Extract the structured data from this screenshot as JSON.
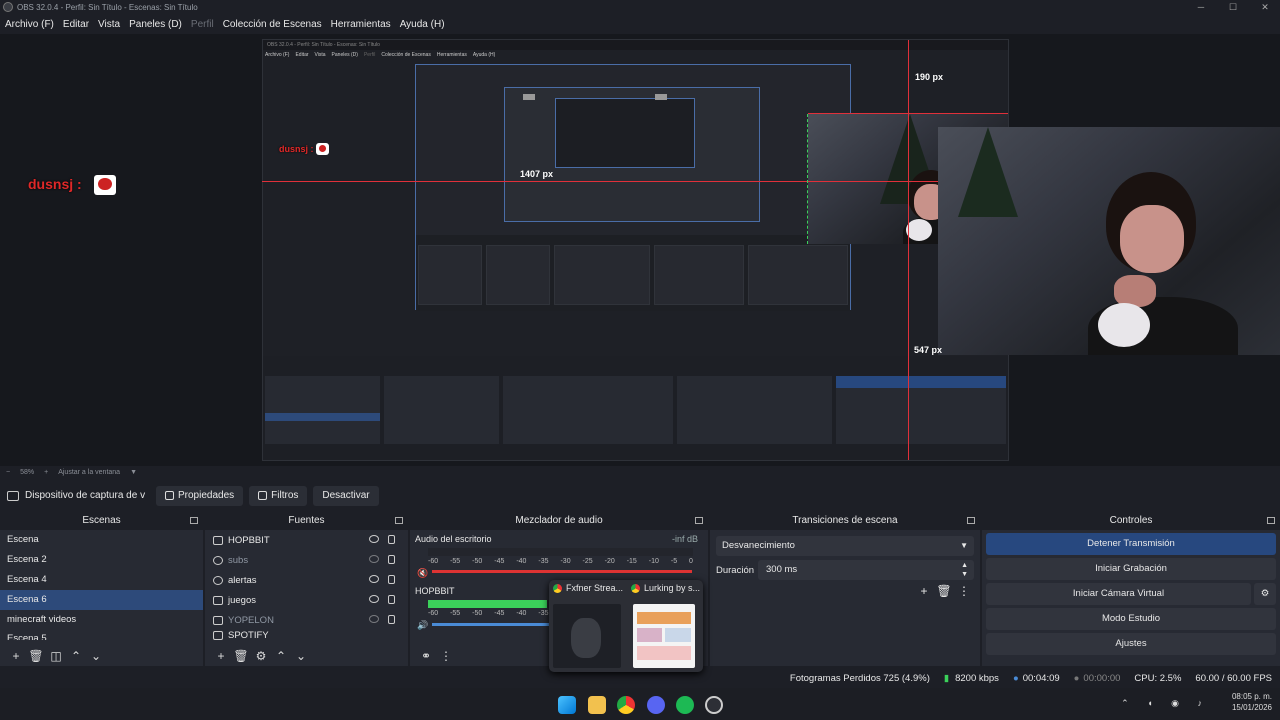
{
  "titlebar": {
    "title": "OBS 32.0.4 - Perfil: Sin Título - Escenas: Sin Título"
  },
  "menu": {
    "archivo": "Archivo (F)",
    "editar": "Editar",
    "vista": "Vista",
    "paneles": "Paneles (D)",
    "perfil": "Perfil",
    "coleccion": "Colección de Escenas",
    "herramientas": "Herramientas",
    "ayuda": "Ayuda (H)"
  },
  "preview": {
    "px_label_1": "190 px",
    "px_label_2": "1407 px",
    "px_label_3": "547 px",
    "chat_name": "dusnsj :",
    "nested_title": "OBS 32.0.4 - Perfil: Sin Título - Escenas: Sin Título",
    "nested_menu": [
      "Archivo (F)",
      "Editar",
      "Vista",
      "Paneles (D)",
      "Perfil",
      "Colección de Escenas",
      "Herramientas",
      "Ayuda (H)"
    ]
  },
  "zoom": {
    "level": "58%",
    "fit": "Ajustar a la ventana"
  },
  "source_toolbar": {
    "name": "Dispositivo de captura de v",
    "props": "Propiedades",
    "filters": "Filtros",
    "deactivate": "Desactivar"
  },
  "scenes": {
    "title": "Escenas",
    "items": [
      "Escena",
      "Escena 2",
      "Escena 4",
      "Escena 6",
      "minecraft videos",
      "Escena 5"
    ]
  },
  "sources": {
    "title": "Fuentes",
    "items": [
      "HOPBBIT",
      "subs",
      "alertas",
      "juegos",
      "YOPELON",
      "SPOTIFY"
    ]
  },
  "mixer": {
    "title": "Mezclador de audio",
    "track1": "Audio del escritorio",
    "track1_db": "-inf dB",
    "track2": "HOPBBIT",
    "scale": [
      "-60",
      "-55",
      "-50",
      "-45",
      "-40",
      "-35",
      "-30",
      "-25",
      "-20",
      "-15",
      "-10",
      "-5",
      "0"
    ]
  },
  "transitions": {
    "title": "Transiciones de escena",
    "selected": "Desvanecimiento",
    "duration_label": "Duración",
    "duration_value": "300 ms"
  },
  "controls": {
    "title": "Controles",
    "stop_stream": "Detener Transmisión",
    "start_rec": "Iniciar Grabación",
    "virtual_cam": "Iniciar Cámara Virtual",
    "studio": "Modo Estudio",
    "settings": "Ajustes"
  },
  "popup": {
    "tab1": "Fxfner Strea...",
    "tab2": "Lurking by s..."
  },
  "status": {
    "dropped": "Fotogramas Perdidos 725 (4.9%)",
    "bitrate": "8200 kbps",
    "stream_time": "00:04:09",
    "rec_time": "00:00:00",
    "cpu": "CPU: 2.5%",
    "fps": "60.00 / 60.00 FPS"
  },
  "taskbar": {
    "time": "08:05 p. m.",
    "date": "15/01/2026"
  },
  "colors": {
    "accent": "#27487f",
    "selection": "#2d4a7a",
    "guide": "#e0303a",
    "meter": "#3bd15a"
  }
}
